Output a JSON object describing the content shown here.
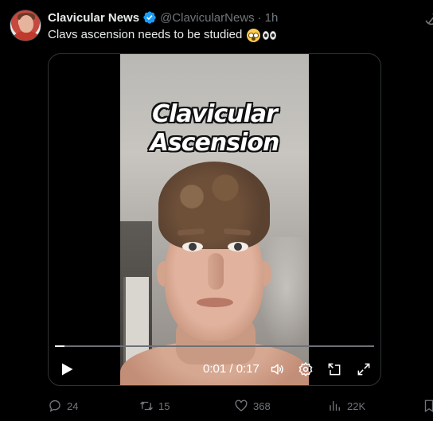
{
  "tweet": {
    "author_name": "Clavicular News",
    "handle": "@ClavicularNews",
    "separator": "·",
    "time": "1h",
    "text": "Clavs ascension needs to be studied"
  },
  "video": {
    "overlay_line1": "Clavicular",
    "overlay_line2": "Ascension",
    "time_display": "0:01 / 0:17",
    "progress_fraction": 0.03
  },
  "actions": {
    "replies": "24",
    "reposts": "15",
    "likes": "368",
    "views": "22K"
  },
  "colors": {
    "background": "#000000",
    "text_primary": "#e7e9ea",
    "text_secondary": "#71767b",
    "verified_blue": "#1d9bf0",
    "border": "#2f3336"
  },
  "icons": [
    "verified-badge-icon",
    "grok-icon",
    "play-icon",
    "volume-icon",
    "settings-icon",
    "pip-icon",
    "fullscreen-icon",
    "reply-icon",
    "repost-icon",
    "like-icon",
    "views-icon",
    "bookmark-icon"
  ]
}
